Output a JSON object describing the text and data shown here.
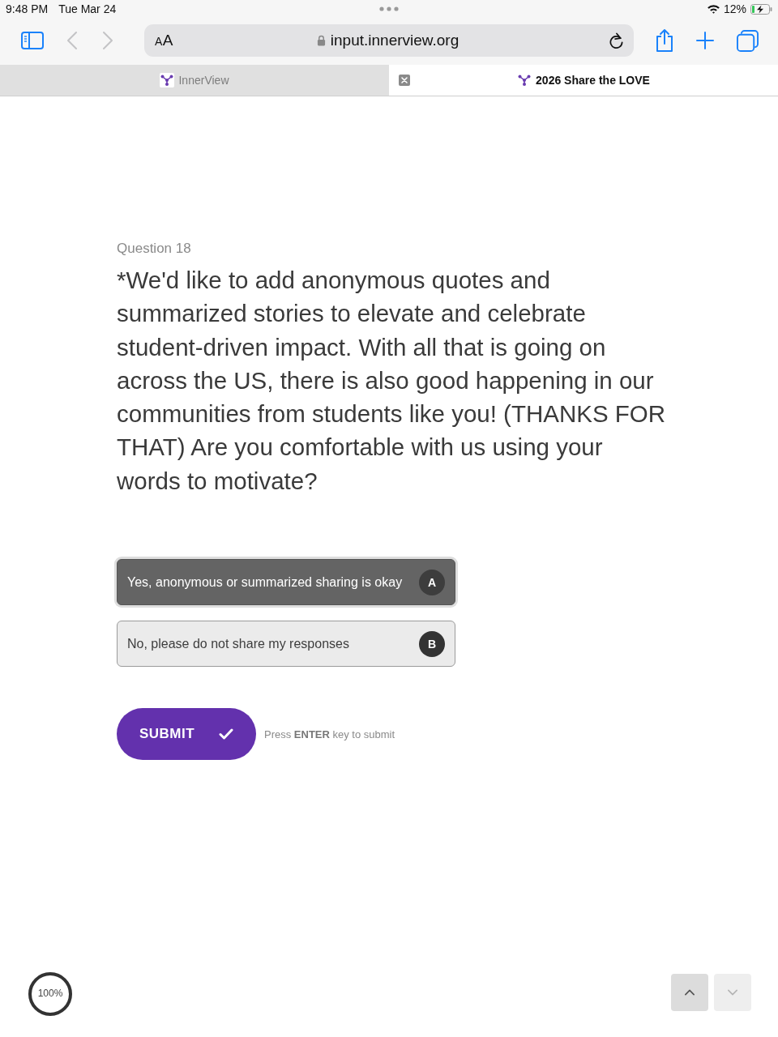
{
  "status_bar": {
    "time": "9:48 PM",
    "date": "Tue Mar 24",
    "battery": "12%",
    "charging": true
  },
  "toolbar": {
    "back": {
      "disabled": true
    },
    "forward": {
      "disabled": true
    },
    "text_size": "AA",
    "url": "input.innerview.org",
    "secure": true
  },
  "tabs": [
    {
      "title": "InnerView",
      "selected": false
    },
    {
      "title": "2026 Share the LOVE",
      "selected": true
    }
  ],
  "form": {
    "question_number": "Question 18",
    "question": "*We'd like to add anonymous quotes and summarized stories to elevate and celebrate student-driven impact. With all that is going on across the US, there is also good happening in our communities from students like you! (THANKS FOR THAT) Are you comfortable with us using your words to motivate?",
    "choices": [
      {
        "label": "Yes, anonymous or summarized sharing is okay",
        "key": "A",
        "selected": true
      },
      {
        "label": "No, please do not share my responses",
        "key": "B",
        "selected": false
      }
    ],
    "submit": "SUBMIT",
    "hint": "Press **ENTER** key to submit"
  },
  "footer": {
    "progress": {
      "label": "100%",
      "level": 1
    },
    "nav": [
      {
        "kind": "up",
        "disabled": false
      },
      {
        "kind": "down",
        "disabled": true
      }
    ]
  }
}
